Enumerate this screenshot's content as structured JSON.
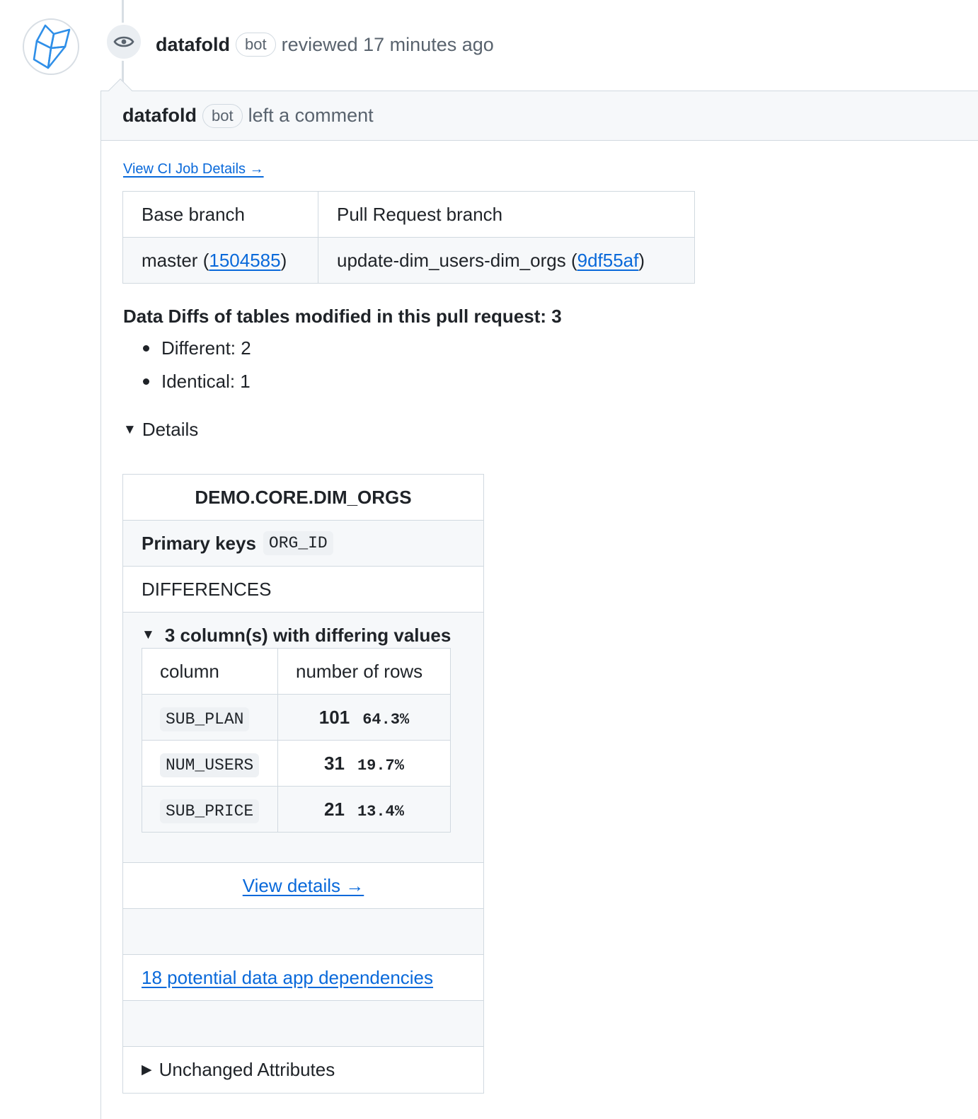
{
  "review": {
    "author": "datafold",
    "badge": "bot",
    "action": "reviewed 17 minutes ago"
  },
  "comment": {
    "author": "datafold",
    "badge": "bot",
    "action": "left a comment",
    "ci_link": "View CI Job Details →"
  },
  "branches": {
    "headers": [
      "Base branch",
      "Pull Request branch"
    ],
    "base_name": "master",
    "base_sha": "1504585",
    "pr_name": "update-dim_users-dim_orgs",
    "pr_sha": "9df55af"
  },
  "summary": {
    "title": "Data Diffs of tables modified in this pull request: 3",
    "items": [
      "Different: 2",
      "Identical: 1"
    ]
  },
  "details": {
    "toggle": "Details",
    "table_name": "DEMO.CORE.DIM_ORGS",
    "primary_keys_label": "Primary keys",
    "primary_key": "ORG_ID",
    "differences_label": "DIFFERENCES",
    "differing_label": "3 column(s) with differing values",
    "columns_header": [
      "column",
      "number of rows"
    ],
    "rows": [
      {
        "column": "SUB_PLAN",
        "count": "101",
        "pct": "64.3%"
      },
      {
        "column": "NUM_USERS",
        "count": "31",
        "pct": "19.7%"
      },
      {
        "column": "SUB_PRICE",
        "count": "21",
        "pct": "13.4%"
      }
    ],
    "view_details": "View details →",
    "dependencies": "18 potential data app dependencies",
    "unchanged": "Unchanged Attributes"
  },
  "colors": {
    "link": "#0969da",
    "muted": "#59636e",
    "border": "#d1d9e0",
    "header_bg": "#f6f8fa",
    "logo": "#2f8fe8"
  },
  "icons": [
    "datafold-logo-icon",
    "eye-icon",
    "triangle-down-icon",
    "triangle-right-icon"
  ]
}
